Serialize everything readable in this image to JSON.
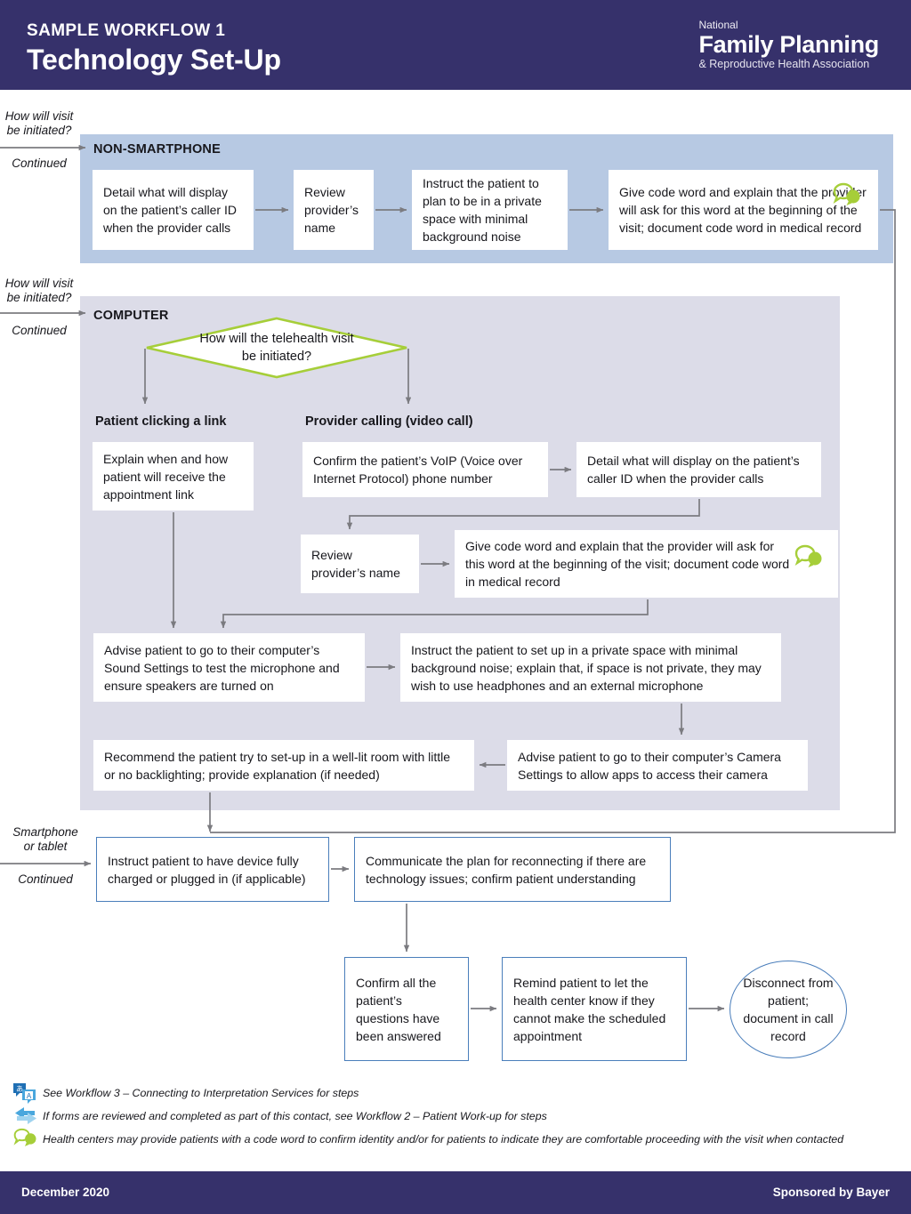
{
  "header": {
    "kicker": "SAMPLE WORKFLOW 1",
    "title": "Technology Set-Up",
    "logo_line1": "National",
    "logo_line2": "Family Planning",
    "logo_line3": "& Reproductive Health Association",
    "bg_color": "#36316b"
  },
  "entries": {
    "nonsmartphone": {
      "question": "How will visit\nbe initiated?",
      "q1": "How will visit",
      "q2": "be initiated?",
      "continued": "Continued"
    },
    "computer": {
      "q1": "How will visit",
      "q2": "be initiated?",
      "continued": "Continued"
    },
    "smartphone": {
      "q1": "Smartphone",
      "q2": "or tablet",
      "continued": "Continued"
    }
  },
  "bands": {
    "nonsmartphone": {
      "label": "NON-SMARTPHONE",
      "color": "#b7c9e3"
    },
    "computer": {
      "label": "COMPUTER",
      "color": "#dcdce8"
    }
  },
  "decision": {
    "text_line1": "How will the telehealth visit",
    "text_line2": "be initiated?",
    "border_color": "#a6ce39"
  },
  "branches": {
    "left": "Patient clicking a link",
    "right": "Provider calling (video call)"
  },
  "nonsmartphone_steps": [
    {
      "id": "ns1",
      "text": "Detail what will display on the patient’s caller ID when the provider calls"
    },
    {
      "id": "ns2",
      "text": "Review provider’s name"
    },
    {
      "id": "ns3",
      "text": "Instruct the patient to plan to be in a private space with minimal background noise"
    },
    {
      "id": "ns4",
      "text": "Give code word and explain that the provider will ask for this word at the beginning of the visit; document code word in medical record",
      "icon": "speech-bubbles-icon"
    }
  ],
  "computer_steps": [
    {
      "id": "c1",
      "text": "Explain when and how patient will receive the appointment link"
    },
    {
      "id": "c2",
      "text": "Confirm the patient’s VoIP (Voice over Internet Protocol) phone number"
    },
    {
      "id": "c3",
      "text": "Detail what will display on the patient’s caller ID when the provider calls"
    },
    {
      "id": "c4",
      "text": "Review provider’s name"
    },
    {
      "id": "c5",
      "text": "Give code word and explain that the provider will ask for this word at the beginning of the visit; document code word in medical record",
      "icon": "speech-bubbles-icon"
    },
    {
      "id": "c6",
      "text": "Advise patient to go to their computer’s Sound Settings to test the microphone and ensure speakers are turned on"
    },
    {
      "id": "c7",
      "text": "Instruct the patient to set up in a private space with minimal background noise; explain that, if space is not private, they may wish to use headphones and an external microphone"
    },
    {
      "id": "c8",
      "text": "Recommend the patient try to set-up in a well-lit room with little or no backlighting; provide explanation (if needed)"
    },
    {
      "id": "c9",
      "text": "Advise patient to go to their computer’s Camera Settings to allow apps to access their camera"
    }
  ],
  "final_steps": [
    {
      "id": "f1",
      "text": "Instruct patient to have device fully charged or plugged in (if applicable)"
    },
    {
      "id": "f2",
      "text": "Communicate the plan for reconnecting if there are technology issues; confirm patient understanding"
    },
    {
      "id": "f3",
      "text": "Confirm all the patient’s questions have been answered"
    },
    {
      "id": "f4",
      "text": "Remind patient to let the health center know if they cannot make the scheduled appointment"
    }
  ],
  "terminator": {
    "text": "Disconnect from patient; document in call record"
  },
  "notes": [
    {
      "icon": "translation-icon",
      "text": "See Workflow 3 – Connecting to Interpretation Services for steps"
    },
    {
      "icon": "exchange-arrows-icon",
      "text": "If forms are reviewed and completed as part of this contact, see Workflow 2 – Patient Work-up for steps"
    },
    {
      "icon": "speech-bubbles-icon",
      "text": "Health centers may provide patients with a code word to confirm identity and/or for patients to indicate they are comfortable proceeding with the visit when contacted"
    }
  ],
  "footer": {
    "date": "December 2020",
    "sponsor": "Sponsored by Bayer"
  },
  "colors": {
    "brand_purple": "#36316b",
    "band_blue": "#b7c9e3",
    "band_lavender": "#dcdce8",
    "accent_green": "#a6ce39",
    "box_blue_border": "#4a7ebb",
    "connector_gray": "#7b7b80"
  }
}
